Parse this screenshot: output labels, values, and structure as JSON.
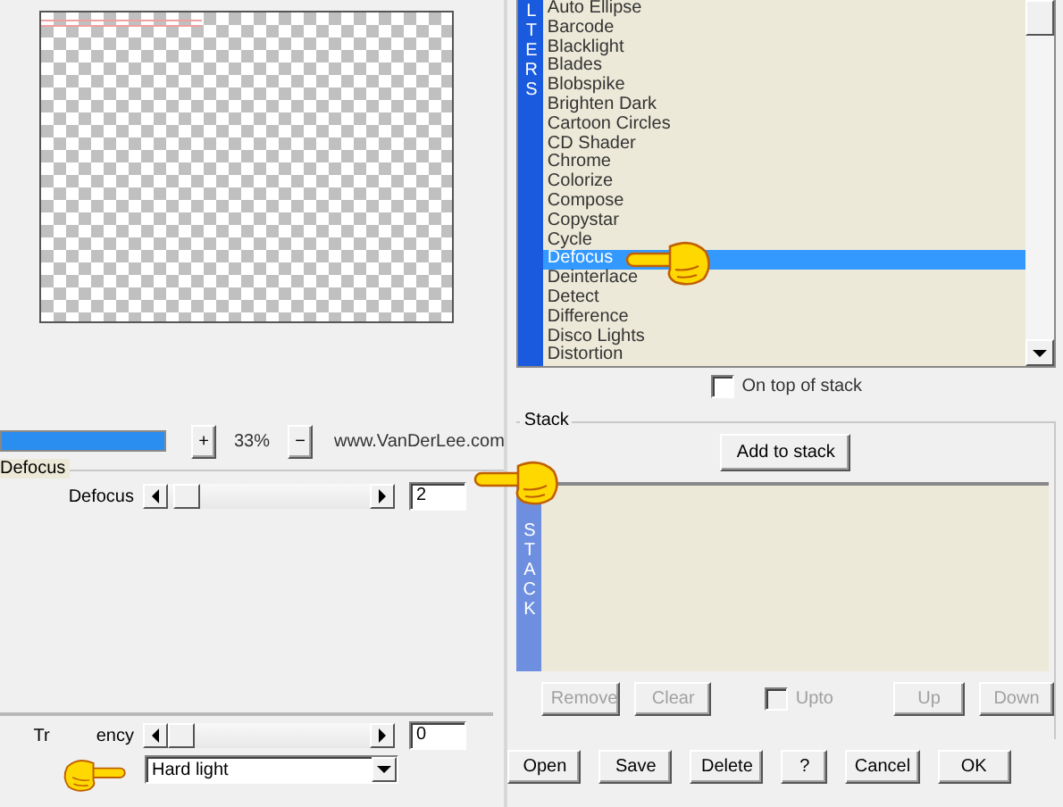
{
  "preview": {
    "progress": {
      "level": 1
    },
    "zoom_in": "+",
    "zoom_value": "33%",
    "zoom_out": "−",
    "link": "www.VanDerLee.com"
  },
  "settings": {
    "title": "Defocus",
    "sliders": [
      {
        "kind": "slider",
        "label_parts": [
          "Defocus"
        ],
        "level": 0.03,
        "value": "2"
      },
      {
        "kind": "slider",
        "label_parts": [
          "Tr",
          "ency"
        ],
        "level": 0,
        "value": "0"
      }
    ],
    "blend_mode": "Hard light"
  },
  "filters": {
    "side_label": "LTERS",
    "items": [
      {
        "label": "Auto Ellipse",
        "selected": false
      },
      {
        "label": "Barcode",
        "selected": false
      },
      {
        "label": "Blacklight",
        "selected": false
      },
      {
        "label": "Blades",
        "selected": false
      },
      {
        "label": "Blobspike",
        "selected": false
      },
      {
        "label": "Brighten Dark",
        "selected": false
      },
      {
        "label": "Cartoon Circles",
        "selected": false
      },
      {
        "label": "CD Shader",
        "selected": false
      },
      {
        "label": "Chrome",
        "selected": false
      },
      {
        "label": "Colorize",
        "selected": false
      },
      {
        "label": "Compose",
        "selected": false
      },
      {
        "label": "Copystar",
        "selected": false
      },
      {
        "label": "Cycle",
        "selected": false
      },
      {
        "label": "Defocus",
        "selected": true
      },
      {
        "label": "Deinterlace",
        "selected": false
      },
      {
        "label": "Detect",
        "selected": false
      },
      {
        "label": "Difference",
        "selected": false
      },
      {
        "label": "Disco Lights",
        "selected": false
      },
      {
        "label": "Distortion",
        "selected": false
      }
    ],
    "on_top_of_stack": {
      "label": "On top of stack",
      "checked": false
    }
  },
  "stack": {
    "title": "Stack",
    "add_button": "Add to stack",
    "side_label": "STACK",
    "buttons": [
      {
        "kind": "button",
        "label": "Remove",
        "disabled": true
      },
      {
        "kind": "button",
        "label": "Clear",
        "disabled": true
      },
      {
        "kind": "checkbox",
        "label": "Upto",
        "checked": false,
        "disabled": true
      },
      {
        "kind": "button",
        "label": "Up",
        "disabled": true
      },
      {
        "kind": "button",
        "label": "Down",
        "disabled": true
      }
    ]
  },
  "buttons": [
    "Open",
    "Save",
    "Delete",
    "?",
    "Cancel",
    "OK"
  ]
}
